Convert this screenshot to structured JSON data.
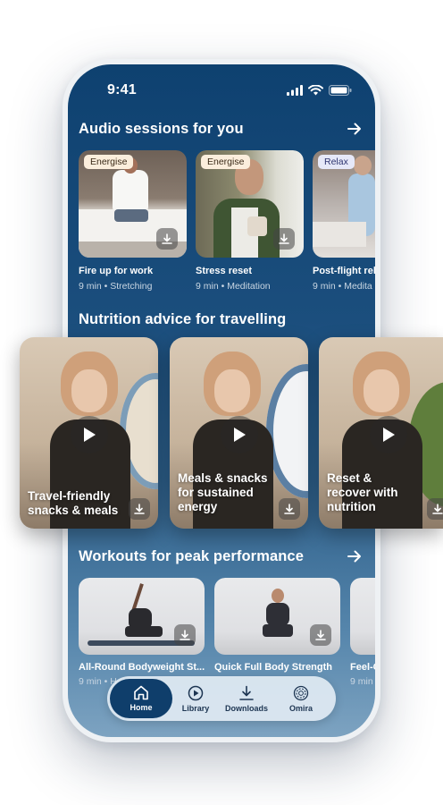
{
  "status_bar": {
    "time": "9:41"
  },
  "audio": {
    "title": "Audio sessions for you",
    "cards": [
      {
        "tag": "Energise",
        "title": "Fire up for work",
        "duration": "9 min",
        "category": "Stretching"
      },
      {
        "tag": "Energise",
        "title": "Stress reset",
        "duration": "9 min",
        "category": "Meditation"
      },
      {
        "tag": "Relax",
        "title": "Post-flight rel",
        "duration": "9 min",
        "category": "Medita"
      }
    ]
  },
  "nutrition": {
    "title": "Nutrition advice for travelling",
    "cards": [
      {
        "title": "Travel-friendly snacks & meals"
      },
      {
        "title": "Meals & snacks for sustained energy"
      },
      {
        "title": "Reset & recover with nutrition"
      }
    ]
  },
  "workouts": {
    "title": "Workouts for peak performance",
    "cards": [
      {
        "title": "All-Round Bodyweight St...",
        "duration": "9 min",
        "category": "H"
      },
      {
        "title": "Quick Full Body Strength",
        "duration": "",
        "category": ""
      },
      {
        "title": "Feel-G",
        "duration": "9 min",
        "category": ""
      }
    ]
  },
  "nav": {
    "items": [
      {
        "label": "Home",
        "icon": "home-icon",
        "active": true
      },
      {
        "label": "Library",
        "icon": "play-circle-icon",
        "active": false
      },
      {
        "label": "Downloads",
        "icon": "download-icon",
        "active": false
      },
      {
        "label": "Omira",
        "icon": "omira-logo-icon",
        "active": false
      }
    ]
  },
  "colors": {
    "accent": "#0f3e6b",
    "screen_top": "#0e4170",
    "chip_energise": "#fbeedc",
    "chip_relax": "#e6e8f8"
  }
}
